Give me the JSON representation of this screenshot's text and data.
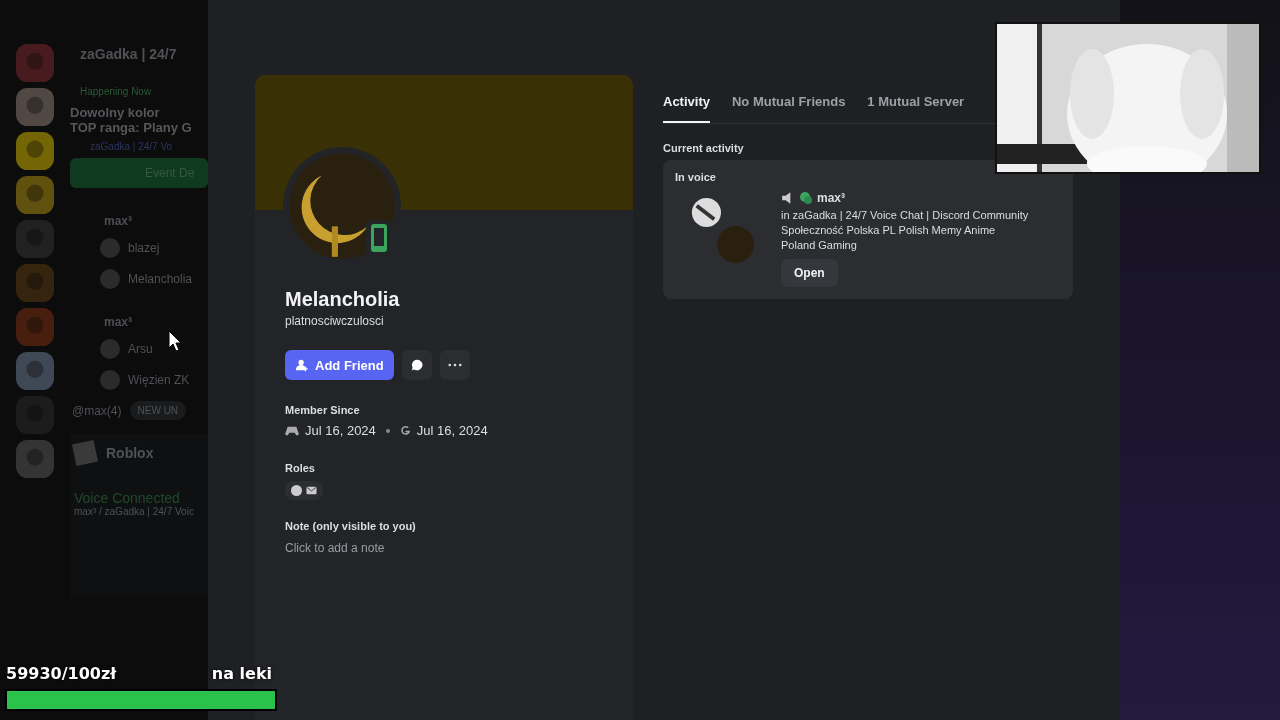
{
  "sidebar": {
    "server_name": "zaGadka | 24/7",
    "event": {
      "status": "Happening Now",
      "title_lines": [
        "Dowolny kolor",
        "TOP ranga: Plany G"
      ],
      "location": "zaGadka | 24/7 Vo",
      "button": "Event De"
    },
    "voice_channels": [
      {
        "name": "max³",
        "users": [
          "blazej",
          "Melancholia"
        ]
      },
      {
        "name": "max³",
        "users": [
          "Arsu",
          "Więzien ZK"
        ]
      }
    ],
    "mention": "@max(4)",
    "new_unreads": "NEW UN",
    "activity": "Roblox",
    "voice_status": "Voice Connected",
    "voice_channel": "max³ / zaGadka | 24/7 Voic"
  },
  "profile": {
    "display_name": "Melancholia",
    "username": "platnosciwczulosci",
    "add_friend": "Add Friend",
    "member_since_label": "Member Since",
    "dates": [
      "Jul 16, 2024",
      "Jul 16, 2024"
    ],
    "roles_label": "Roles",
    "note_label": "Note (only visible to you)",
    "note_placeholder": "Click to add a note"
  },
  "tabs": [
    {
      "label": "Activity",
      "selected": true
    },
    {
      "label": "No Mutual Friends",
      "selected": false
    },
    {
      "label": "1 Mutual Server",
      "selected": false
    }
  ],
  "activity": {
    "heading": "Current activity",
    "card_title": "In voice",
    "channel": "max³",
    "description": "in zaGadka | 24/7 Voice Chat | Discord Community Społeczność Polska PL Polish Memy Anime Poland Gaming",
    "button": "Open"
  },
  "goal": {
    "amount": "59930/100zł",
    "caption": "na leki",
    "level": 1
  }
}
